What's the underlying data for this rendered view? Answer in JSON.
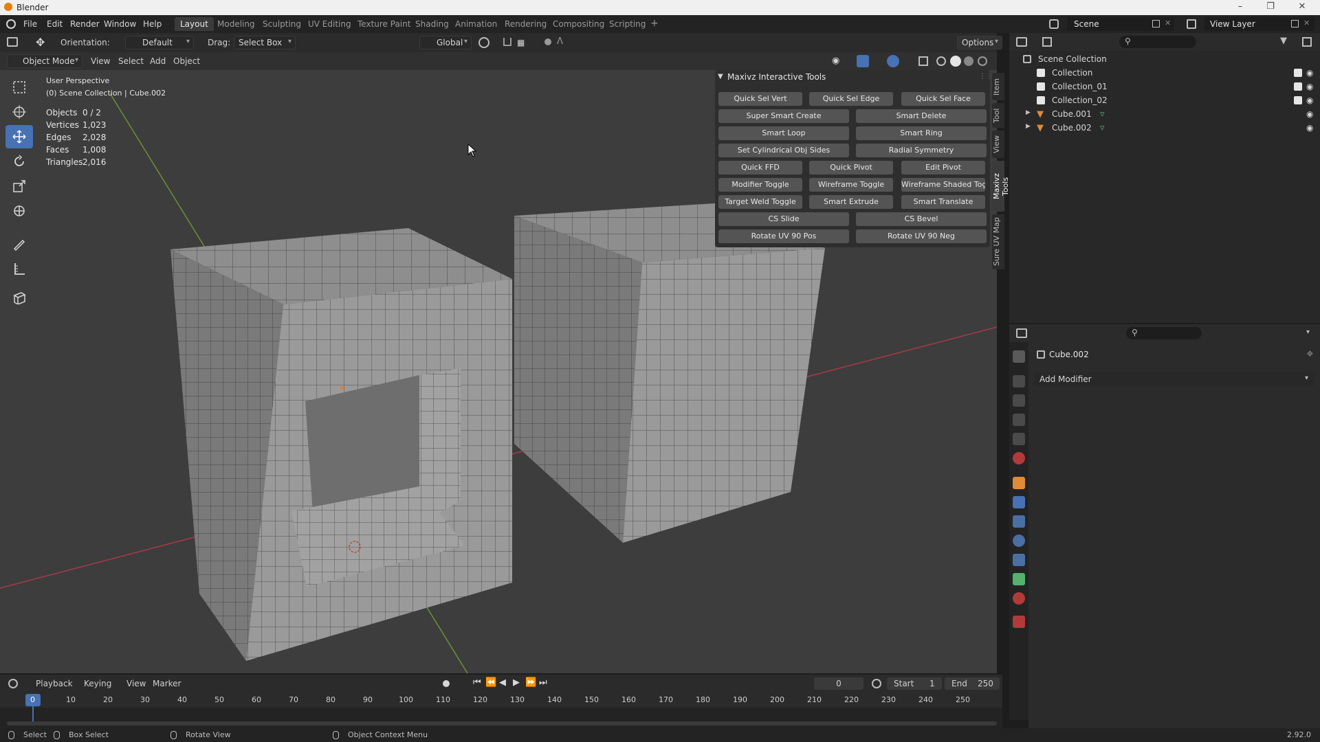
{
  "window": {
    "title": "Blender"
  },
  "menu": {
    "items": [
      "File",
      "Edit",
      "Render",
      "Window",
      "Help"
    ]
  },
  "workspaces": {
    "tabs": [
      "Layout",
      "Modeling",
      "Sculpting",
      "UV Editing",
      "Texture Paint",
      "Shading",
      "Animation",
      "Rendering",
      "Compositing",
      "Scripting"
    ],
    "active": "Layout"
  },
  "scene": {
    "name": "Scene",
    "view_layer": "View Layer"
  },
  "tool_header": {
    "orientation_label": "Orientation:",
    "orientation_value": "Default",
    "drag_label": "Drag:",
    "drag_value": "Select Box",
    "transform_orientation": "Global",
    "options_label": "Options"
  },
  "viewport_header": {
    "mode": "Object Mode",
    "menus": [
      "View",
      "Select",
      "Add",
      "Object"
    ]
  },
  "viewport": {
    "perspective": "User Perspective",
    "collection_path": "(0) Scene Collection | Cube.002",
    "stats": [
      {
        "label": "Objects",
        "value": "0 / 2"
      },
      {
        "label": "Vertices",
        "value": "1,023"
      },
      {
        "label": "Edges",
        "value": "2,028"
      },
      {
        "label": "Faces",
        "value": "1,008"
      },
      {
        "label": "Triangles",
        "value": "2,016"
      }
    ]
  },
  "npanel": {
    "title": "Maxivz Interactive Tools",
    "buttons": [
      "Quick Sel Vert",
      "Quick Sel Edge",
      "Quick Sel Face",
      "Super Smart Create",
      "Smart Delete",
      "Smart Loop",
      "Smart Ring",
      "Set Cylindrical Obj Sides",
      "Radial Symmetry",
      "Quick FFD",
      "Quick Pivot",
      "Edit Pivot",
      "Modifier Toggle",
      "Wireframe Toggle",
      "Wireframe Shaded Tog...",
      "Target Weld Toggle",
      "Smart Extrude",
      "Smart Translate",
      "CS Slide",
      "CS Bevel",
      "Rotate UV 90 Pos",
      "Rotate UV 90 Neg"
    ],
    "side_tabs": [
      "Item",
      "Tool",
      "View",
      "Maxivz Tools",
      "Sure UV Map"
    ],
    "active_tab": "Maxivz Tools"
  },
  "outliner": {
    "root": "Scene Collection",
    "items": [
      {
        "name": "Collection",
        "type": "collection"
      },
      {
        "name": "Collection_01",
        "type": "collection"
      },
      {
        "name": "Collection_02",
        "type": "collection"
      },
      {
        "name": "Cube.001",
        "type": "mesh"
      },
      {
        "name": "Cube.002",
        "type": "mesh"
      }
    ]
  },
  "properties": {
    "object_name": "Cube.002",
    "add_modifier_label": "Add Modifier"
  },
  "timeline": {
    "menus": [
      "Playback",
      "Keying",
      "View",
      "Marker"
    ],
    "current_frame": "0",
    "start_label": "Start",
    "start_value": "1",
    "end_label": "End",
    "end_value": "250",
    "ticks": [
      "0",
      "10",
      "20",
      "30",
      "40",
      "50",
      "60",
      "70",
      "80",
      "90",
      "100",
      "110",
      "120",
      "130",
      "140",
      "150",
      "160",
      "170",
      "180",
      "190",
      "200",
      "210",
      "220",
      "230",
      "240",
      "250"
    ]
  },
  "statusbar": {
    "select": "Select",
    "box_select": "Box Select",
    "rotate_view": "Rotate View",
    "context_menu": "Object Context Menu",
    "version": "2.92.0"
  },
  "colors": {
    "accent": "#4772b3",
    "x_axis": "#b03a48",
    "y_axis": "#7aa23a",
    "mesh_face": "#8e8e8e"
  }
}
